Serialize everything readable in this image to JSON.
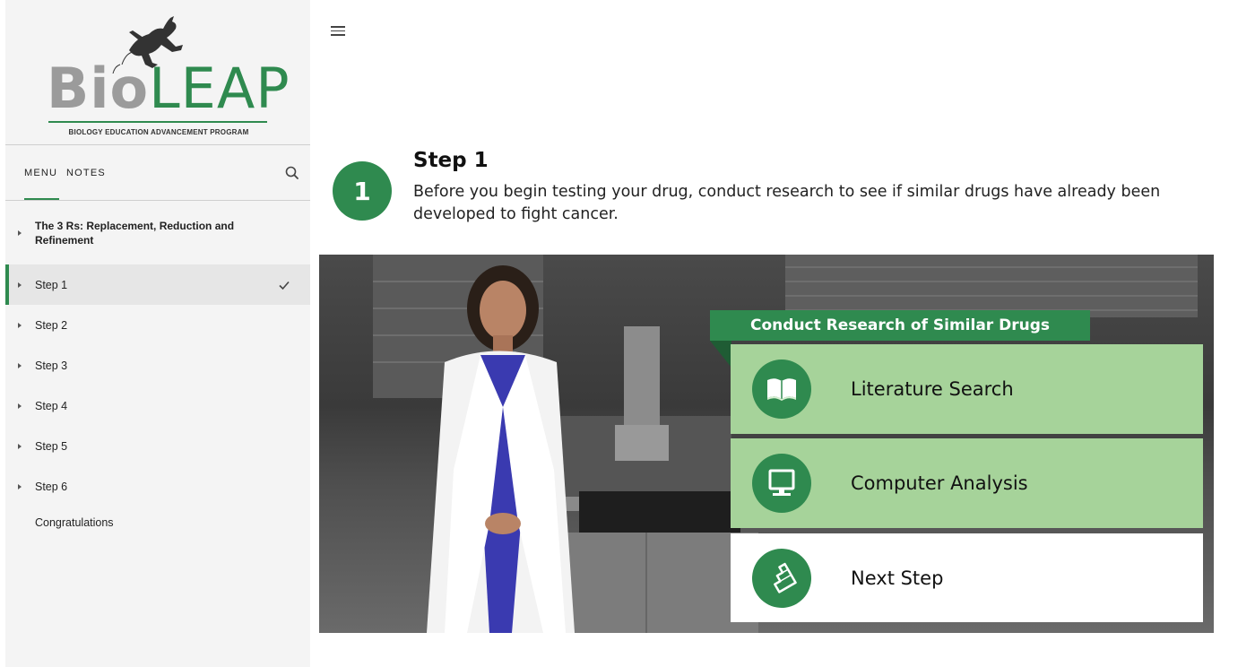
{
  "logo": {
    "word_bio": "Bio",
    "word_leap": "LEAP",
    "tagline": "BIOLOGY EDUCATION ADVANCEMENT PROGRAM"
  },
  "sidebar": {
    "tabs": [
      {
        "label": "MENU",
        "active": true
      },
      {
        "label": "NOTES",
        "active": false
      }
    ],
    "items": [
      {
        "label": "The 3 Rs: Replacement, Reduction and Refinement"
      },
      {
        "label": "Step 1",
        "completed": true,
        "active": true
      },
      {
        "label": "Step 2"
      },
      {
        "label": "Step 3"
      },
      {
        "label": "Step 4"
      },
      {
        "label": "Step 5"
      },
      {
        "label": "Step 6"
      },
      {
        "label": "Congratulations"
      }
    ]
  },
  "main": {
    "step_number": "1",
    "step_title": "Step 1",
    "step_description": "Before you begin testing your drug, conduct research to see if similar drugs have already been developed to fight cancer.",
    "panel": {
      "header": "Conduct Research of Similar Drugs",
      "choices": [
        {
          "label": "Literature Search",
          "icon": "open-book-icon"
        },
        {
          "label": "Computer Analysis",
          "icon": "computer-monitor-icon"
        },
        {
          "label": "Next Step",
          "icon": "stairs-icon"
        }
      ]
    }
  },
  "colors": {
    "accent": "#2f8a4f",
    "choice_green": "#a6d39a"
  }
}
